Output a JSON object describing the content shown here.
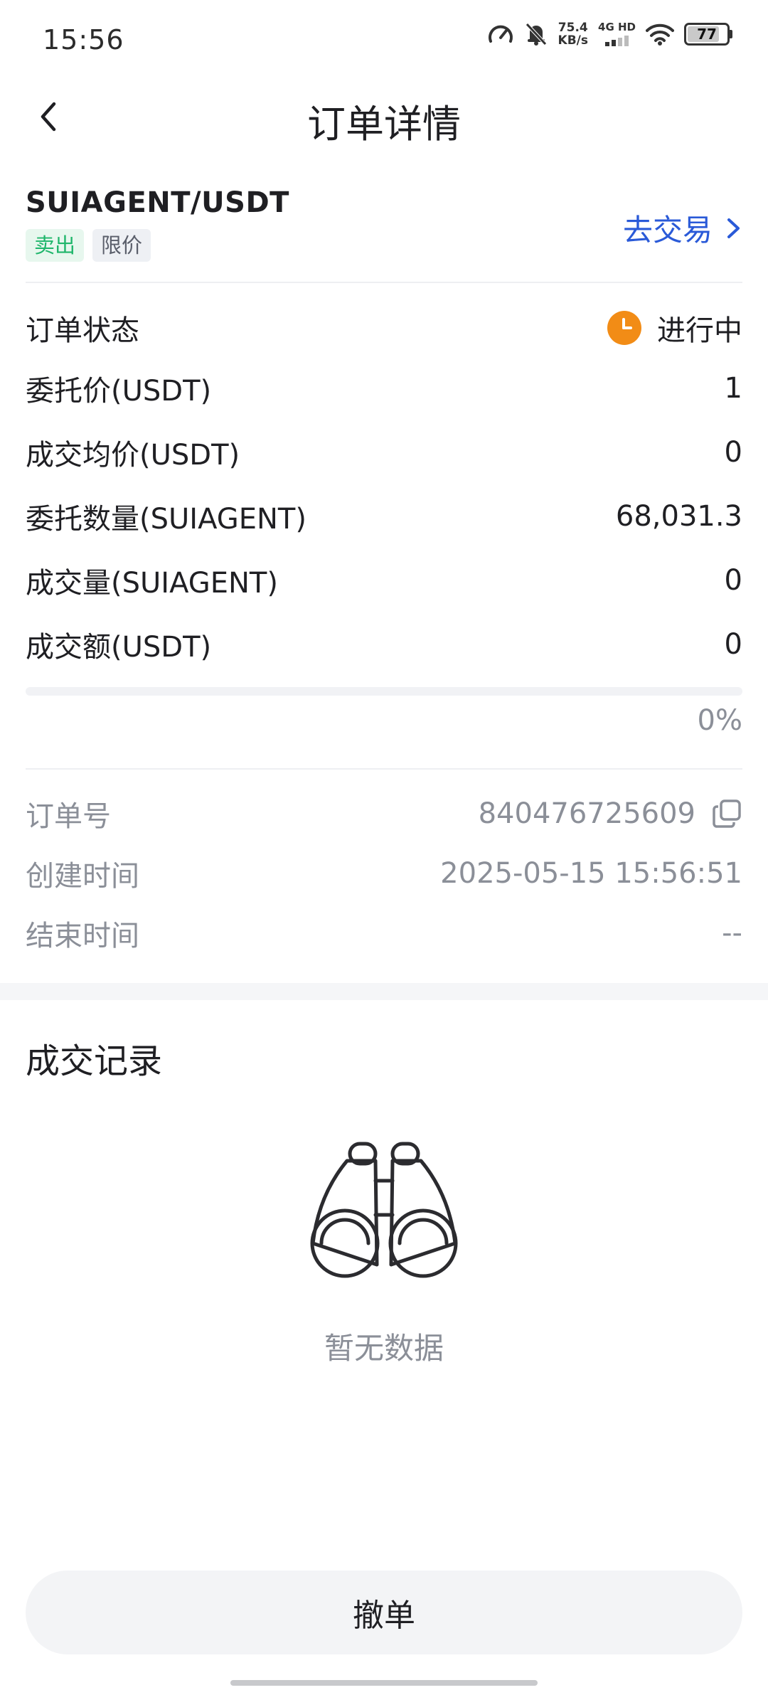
{
  "status_bar": {
    "time": "15:56",
    "net_speed_value": "75.4",
    "net_speed_unit": "KB/s",
    "signal_label": "4G HD",
    "battery": "77"
  },
  "nav": {
    "title": "订单详情"
  },
  "order": {
    "pair": "SUIAGENT/USDT",
    "side_tag": "卖出",
    "type_tag": "限价",
    "trade_link": "去交易"
  },
  "details": [
    {
      "label": "订单状态",
      "value": "进行中"
    },
    {
      "label": "委托价(USDT)",
      "value": "1"
    },
    {
      "label": "成交均价(USDT)",
      "value": "0"
    },
    {
      "label": "委托数量(SUIAGENT)",
      "value": "68,031.3"
    },
    {
      "label": "成交量(SUIAGENT)",
      "value": "0"
    },
    {
      "label": "成交额(USDT)",
      "value": "0"
    }
  ],
  "progress": {
    "percent": 0,
    "text": "0%"
  },
  "meta": [
    {
      "label": "订单号",
      "value": "840476725609"
    },
    {
      "label": "创建时间",
      "value": "2025-05-15 15:56:51"
    },
    {
      "label": "结束时间",
      "value": "--"
    }
  ],
  "trades_section": {
    "title": "成交记录",
    "empty_text": "暂无数据"
  },
  "cancel_button": "撤单",
  "colors": {
    "accent": "#2a5ad8",
    "sell": "#1fb66b",
    "status_pending": "#f28c16"
  },
  "icons": [
    "back-arrow-icon",
    "chevron-right-icon",
    "clock-icon",
    "copy-icon",
    "binoculars-icon"
  ]
}
